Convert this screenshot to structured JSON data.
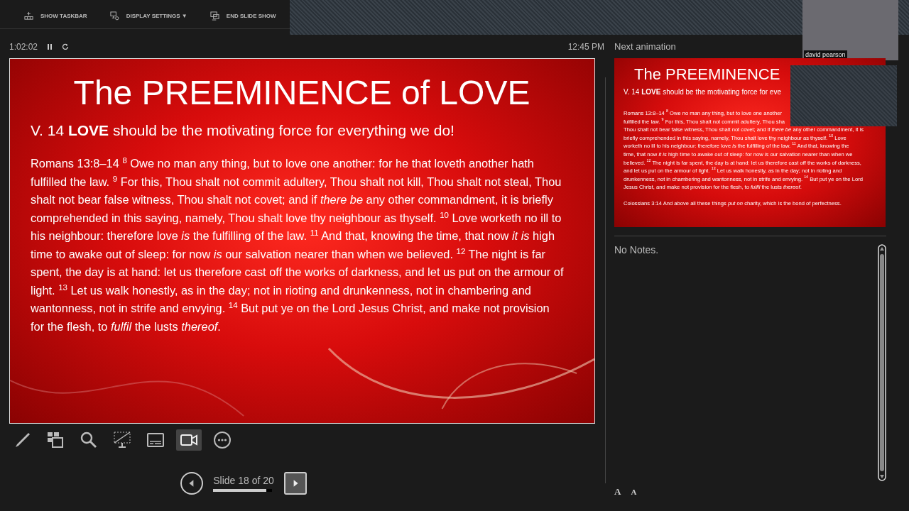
{
  "top_bar": {
    "buttons": [
      {
        "kind": "taskbar",
        "label": "SHOW TASKBAR"
      },
      {
        "kind": "display",
        "label": "DISPLAY SETTINGS ▼"
      },
      {
        "kind": "end",
        "label": "END SLIDE SHOW"
      }
    ]
  },
  "video_thumbnail": {
    "name": "david pearson"
  },
  "timer": {
    "elapsed": "1:02:02",
    "clock": "12:45 PM"
  },
  "current_slide": {
    "title": "The PREEMINENCE of LOVE",
    "subtitle": "V. 14 **LOVE** should be the motivating force for everything we do!",
    "body": "Romans 13:8–14 $^{8}$ Owe no man any thing, but to love one another: for he that loveth another hath fulfilled the law. $^{9}$ For this, Thou shalt not commit adultery, Thou shalt not kill, Thou shalt not steal, Thou shalt not bear false witness, Thou shalt not covet; and if *there be* any other commandment, it is briefly comprehended in this saying, namely, Thou shalt love thy neighbour as thyself. $^{10}$ Love worketh no ill to his neighbour: therefore love *is* the fulfilling of the law. $^{11}$ And that, knowing the time, that now *it is* high time to awake out of sleep: for now *is* our salvation nearer than when we believed. $^{12}$ The night is far spent, the day is at hand: let us therefore cast off the works of darkness, and let us put on the armour of light. $^{13}$ Let us walk honestly, as in the day; not in rioting and drunkenness, not in chambering and wantonness, not in strife and envying. $^{14}$ But put ye on the Lord Jesus Christ, and make not provision for the flesh, to *fulfil* the lusts *thereof*."
  },
  "tools": [
    {
      "kind": "pen",
      "active": false
    },
    {
      "kind": "slides",
      "active": false
    },
    {
      "kind": "zoom",
      "active": false
    },
    {
      "kind": "black",
      "active": false
    },
    {
      "kind": "subtitles",
      "active": false
    },
    {
      "kind": "camera",
      "active": true
    },
    {
      "kind": "more",
      "active": false
    }
  ],
  "navigation": {
    "label": "Slide 18 of 20",
    "level": 0.9
  },
  "next_panel": {
    "heading": "Next animation",
    "title": "The PREEMINENCE",
    "subtitle": "V. 14 **LOVE** should be the motivating force for eve",
    "lines": [
      "Romans 13:8–14 $^{8}$ Owe no man any thing, but to love one another",
      "fulfilled the law. $^{9}$ For this, Thou shalt not commit adultery, Thou sha",
      "Thou shalt not bear false witness, Thou shalt not covet; and if *there be* any other commandment, it is",
      "briefly comprehended in this saying, namely, Thou shalt love thy neighbour as thyself. $^{10}$ Love",
      "worketh no ill to his neighbour: therefore love *is* the fulfilling of the law. $^{11}$ And that, knowing the",
      "time, that now *it is* high time to awake out of sleep: for now *is* our salvation nearer than when we",
      "believed. $^{12}$ The night is far spent, the day is at hand: let us therefore cast off the works of darkness,",
      "and let us put on the armour of light. $^{13}$ Let us walk honestly, as in the day; not in rioting and",
      "drunkenness, not in chambering and wantonness, not in strife and envying. $^{14}$ But put ye on the Lord",
      "Jesus Christ, and make not provision for the flesh, to *fulfil* the lusts *thereof*."
    ],
    "footer": "Colossians 3:14  And above all these things *put on* charity, which is the bond of perfectness."
  },
  "notes": {
    "text": "No Notes.",
    "font_buttons": [
      "A",
      "A"
    ]
  }
}
